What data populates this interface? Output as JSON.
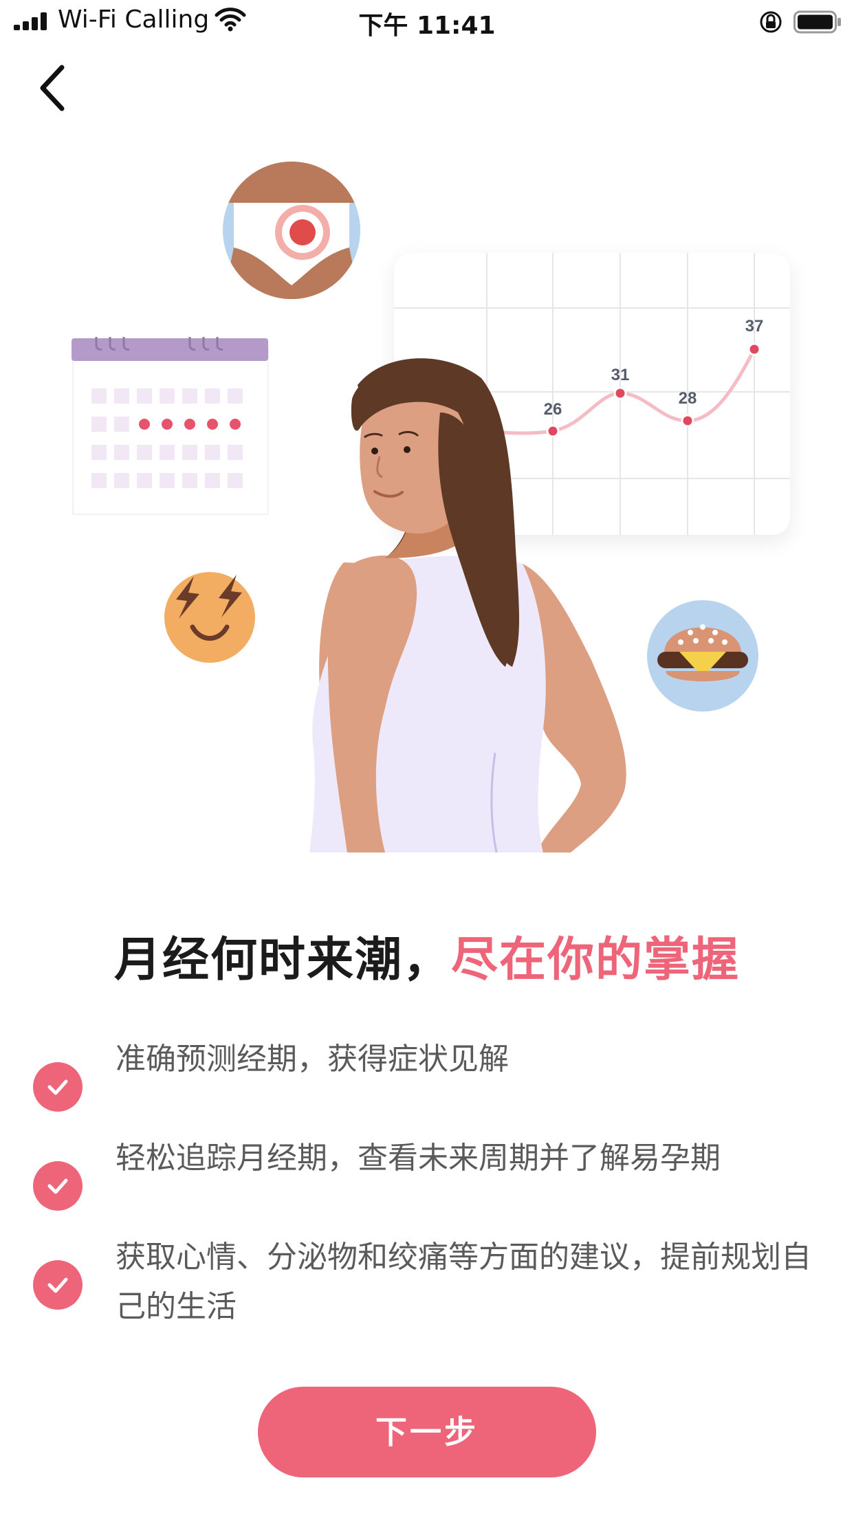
{
  "status_bar": {
    "carrier": "Wi-Fi Calling",
    "time": "下午 11:41"
  },
  "nav": {
    "back_icon": "chevron-left-icon"
  },
  "illustration": {
    "chart_points": [
      "26",
      "31",
      "28",
      "37"
    ],
    "icons": [
      "pelvis-target-icon",
      "calendar-icon",
      "lightning-eyes-emoji-icon",
      "burger-icon",
      "woman-figure"
    ]
  },
  "headline": {
    "part1": "月经何时来潮，",
    "part2": "尽在你的掌握"
  },
  "features": [
    {
      "text": "准确预测经期，获得症状见解"
    },
    {
      "text": "轻松追踪月经期，查看未来周期并了解易孕期"
    },
    {
      "text": "获取心情、分泌物和绞痛等方面的建议，提前规划自己的生活"
    }
  ],
  "next_button": {
    "label": "下一步"
  },
  "colors": {
    "accent": "#ee6479",
    "text_secondary": "#5a5a5a"
  }
}
